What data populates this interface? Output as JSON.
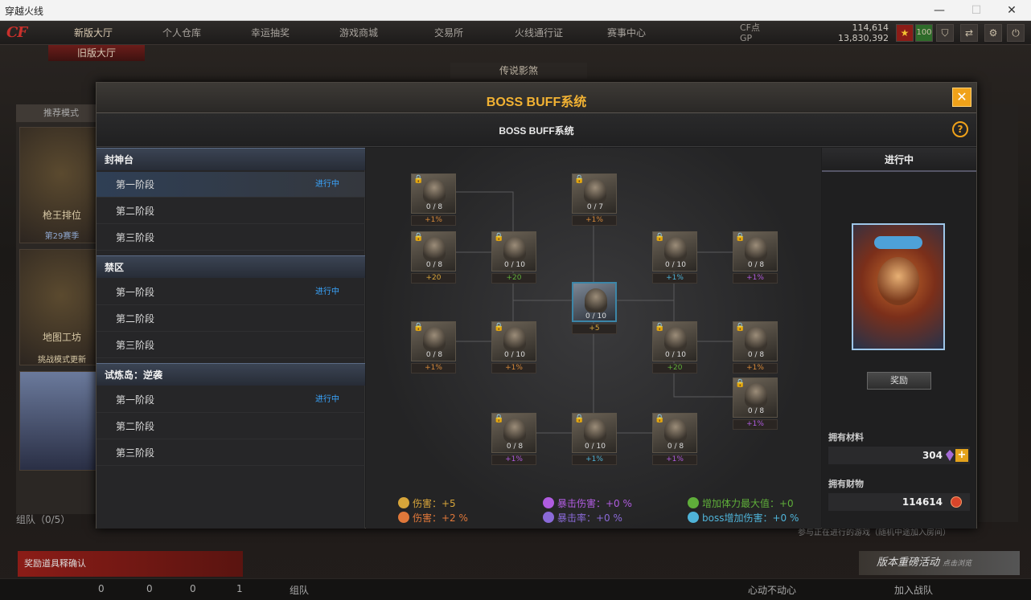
{
  "window": {
    "title": "穿越火线"
  },
  "nav": {
    "logo": "CF",
    "items": [
      "新版大厅",
      "个人仓库",
      "幸运抽奖",
      "游戏商城",
      "交易所",
      "火线通行证",
      "赛事中心"
    ],
    "sub_item": "旧版大厅",
    "legend_title": "传说影煞"
  },
  "currency": {
    "cf_label": "CF点",
    "cf_value": "114,614",
    "gp_label": "GP",
    "gp_value": "13,830,392",
    "level": "100"
  },
  "background": {
    "recommend": "推荐模式",
    "card1": "枪王排位",
    "card1_sub": "第29赛季",
    "card2": "地图工坊",
    "card2_sub": "挑战模式更新",
    "team": "组队（0/5）",
    "reward_confirm": "奖励道具释确认",
    "bottom_team": "组队",
    "bottom_chat": "心动不动心",
    "bottom_join": "加入战队",
    "event_banner": "版本重磅活动",
    "event_sub": "点击浏览",
    "join_hint": "参与正在进行的游戏（随机中途加入房间）",
    "count_a": "0",
    "count_b": "0",
    "count_c": "0",
    "count_d": "1"
  },
  "modal": {
    "title": "BOSS BUFF系统",
    "subtitle": "BOSS BUFF系统",
    "close": "✕",
    "help": "?"
  },
  "stage_groups": [
    {
      "name": "封神台",
      "stages": [
        {
          "label": "第一阶段",
          "badge": "进行中"
        },
        {
          "label": "第二阶段",
          "badge": ""
        },
        {
          "label": "第三阶段",
          "badge": ""
        }
      ]
    },
    {
      "name": "禁区",
      "stages": [
        {
          "label": "第一阶段",
          "badge": "进行中"
        },
        {
          "label": "第二阶段",
          "badge": ""
        },
        {
          "label": "第三阶段",
          "badge": ""
        }
      ]
    },
    {
      "name": "试炼岛：逆袭",
      "stages": [
        {
          "label": "第一阶段",
          "badge": "进行中"
        },
        {
          "label": "第二阶段",
          "badge": ""
        },
        {
          "label": "第三阶段",
          "badge": ""
        }
      ]
    }
  ],
  "tree_nodes": [
    {
      "count": "0 / 8",
      "buff": "+1%",
      "kind": "dmg",
      "locked": true
    },
    {
      "count": "0 / 7",
      "buff": "+1%",
      "kind": "dmg",
      "locked": true
    },
    {
      "count": "0 / 8",
      "buff": "+20",
      "kind": "atk",
      "locked": true
    },
    {
      "count": "0 / 10",
      "buff": "+20",
      "kind": "hp",
      "locked": true
    },
    {
      "count": "0 / 10",
      "buff": "+1%",
      "kind": "boss",
      "locked": true
    },
    {
      "count": "0 / 8",
      "buff": "+1%",
      "kind": "crit",
      "locked": true
    },
    {
      "count": "0 / 10",
      "buff": "+5",
      "kind": "atk",
      "locked": false
    },
    {
      "count": "0 / 8",
      "buff": "+1%",
      "kind": "dmg",
      "locked": true
    },
    {
      "count": "0 / 10",
      "buff": "+1%",
      "kind": "dmg",
      "locked": true
    },
    {
      "count": "0 / 10",
      "buff": "+20",
      "kind": "hp",
      "locked": true
    },
    {
      "count": "0 / 8",
      "buff": "+1%",
      "kind": "dmg",
      "locked": true
    },
    {
      "count": "0 / 8",
      "buff": "+1%",
      "kind": "crit",
      "locked": true
    },
    {
      "count": "0 / 8",
      "buff": "+1%",
      "kind": "crit",
      "locked": true
    },
    {
      "count": "0 / 10",
      "buff": "+1%",
      "kind": "boss",
      "locked": true
    },
    {
      "count": "0 / 8",
      "buff": "+1%",
      "kind": "crit",
      "locked": true
    }
  ],
  "stats": [
    {
      "label": "伤害：+5",
      "color": "#d7a53a"
    },
    {
      "label": "暴击伤害：+0 %",
      "color": "#b05ce0"
    },
    {
      "label": "增加体力最大值：+0",
      "color": "#5fae3a"
    },
    {
      "label": "伤害：+2 %",
      "color": "#e0783a"
    },
    {
      "label": "暴击率：+0 %",
      "color": "#8a6ad8"
    },
    {
      "label": "boss增加伤害：+0 %",
      "color": "#4fb3d8"
    }
  ],
  "right_panel": {
    "status": "进行中",
    "reward_button": "奖励",
    "material_label": "拥有材料",
    "material_value": "304",
    "wealth_label": "拥有财物",
    "wealth_value": "114614"
  }
}
